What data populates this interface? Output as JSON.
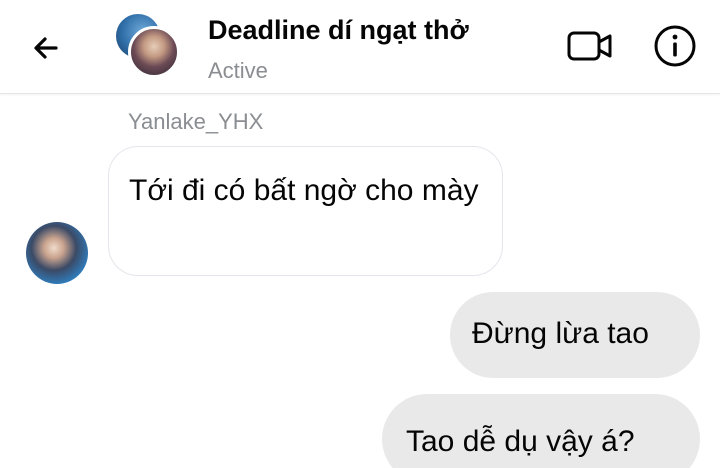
{
  "header": {
    "back_icon": "arrow-left-icon",
    "title": "Deadline dí ngạt thở",
    "status": "Active",
    "video_icon": "video-camera-icon",
    "info_icon": "info-icon"
  },
  "conversation": {
    "sender_name": "Yanlake_YHX",
    "messages": [
      {
        "direction": "incoming",
        "text": "Tới đi có bất ngờ cho mày"
      },
      {
        "direction": "outgoing",
        "text": "Đừng lừa tao"
      },
      {
        "direction": "outgoing",
        "text": "Tao dễ dụ vậy á?"
      }
    ]
  },
  "colors": {
    "incoming_border": "#e4e6eb",
    "outgoing_bg": "#e9e9e9",
    "muted_text": "#8a8d91"
  }
}
